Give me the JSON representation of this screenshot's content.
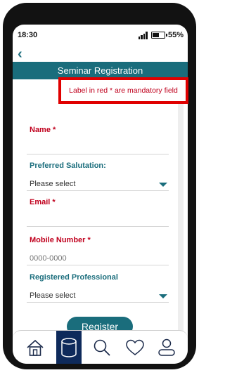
{
  "status_bar": {
    "time": "18:30",
    "battery_percent": "55%",
    "battery_level": 0.55
  },
  "nav": {
    "back_icon": "chevron-left-icon"
  },
  "header": {
    "title": "Seminar Registration"
  },
  "note": {
    "text": "Label in red * are mandatory field"
  },
  "form": {
    "name": {
      "label": "Name *",
      "value": ""
    },
    "salutation": {
      "label": "Preferred Salutation:",
      "placeholder": "Please select"
    },
    "email": {
      "label": "Email *",
      "value": ""
    },
    "mobile": {
      "label": "Mobile Number *",
      "placeholder": "0000-0000"
    },
    "professional": {
      "label": "Registered Professional",
      "placeholder": "Please select"
    },
    "submit_label": "Register"
  },
  "tab_bar": {
    "items": [
      {
        "icon": "home-icon",
        "active": false
      },
      {
        "icon": "database-icon",
        "active": true
      },
      {
        "icon": "search-icon",
        "active": false
      },
      {
        "icon": "heart-icon",
        "active": false
      },
      {
        "icon": "user-icon",
        "active": false
      }
    ]
  },
  "colors": {
    "accent": "#1a6d7c",
    "mandatory_label": "#c0001d",
    "active_tab": "#0e2a5b",
    "note_border": "#e00000"
  }
}
